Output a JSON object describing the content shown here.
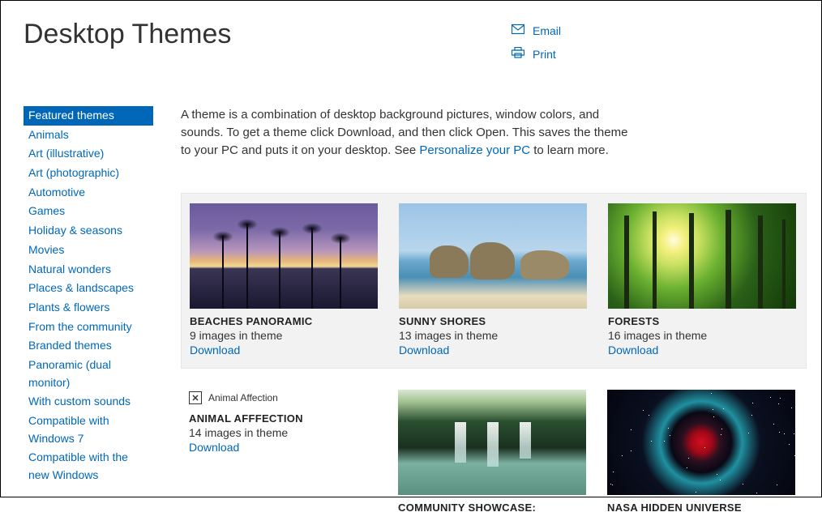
{
  "page": {
    "title": "Desktop Themes"
  },
  "actions": {
    "email": "Email",
    "print": "Print"
  },
  "sidebar": {
    "items": [
      {
        "label": "Featured themes",
        "active": true
      },
      {
        "label": "Animals"
      },
      {
        "label": "Art (illustrative)"
      },
      {
        "label": "Art (photographic)"
      },
      {
        "label": "Automotive"
      },
      {
        "label": "Games"
      },
      {
        "label": "Holiday & seasons"
      },
      {
        "label": "Movies"
      },
      {
        "label": "Natural wonders"
      },
      {
        "label": "Places & landscapes"
      },
      {
        "label": "Plants & flowers"
      },
      {
        "label": "From the community"
      },
      {
        "label": "Branded themes"
      },
      {
        "label": "Panoramic (dual monitor)"
      },
      {
        "label": "With custom sounds"
      },
      {
        "label": "Compatible with Windows 7"
      },
      {
        "label": "Compatible with the new Windows"
      }
    ]
  },
  "intro": {
    "text_before": "A theme is a combination of desktop background pictures, window colors, and sounds. To get a theme click Download, and then click Open. This saves the theme to your PC and puts it on your desktop. See ",
    "link": "Personalize your PC",
    "text_after": " to learn more."
  },
  "download_label": "Download",
  "themes": {
    "row1": [
      {
        "title": "BEACHES PANORAMIC",
        "count": "9 images in theme",
        "thumb": "beach"
      },
      {
        "title": "SUNNY SHORES",
        "count": "13 images in theme",
        "thumb": "shores"
      },
      {
        "title": "FORESTS",
        "count": "16 images in theme",
        "thumb": "forest"
      }
    ],
    "row2": [
      {
        "title": "ANIMAL AFFFECTION",
        "count": "14 images in theme",
        "thumb": "broken",
        "alt": "Animal Affection"
      },
      {
        "title": "COMMUNITY SHOWCASE:",
        "count": "",
        "thumb": "waterfall"
      },
      {
        "title": "NASA HIDDEN UNIVERSE",
        "count": "",
        "thumb": "nasa"
      }
    ]
  }
}
